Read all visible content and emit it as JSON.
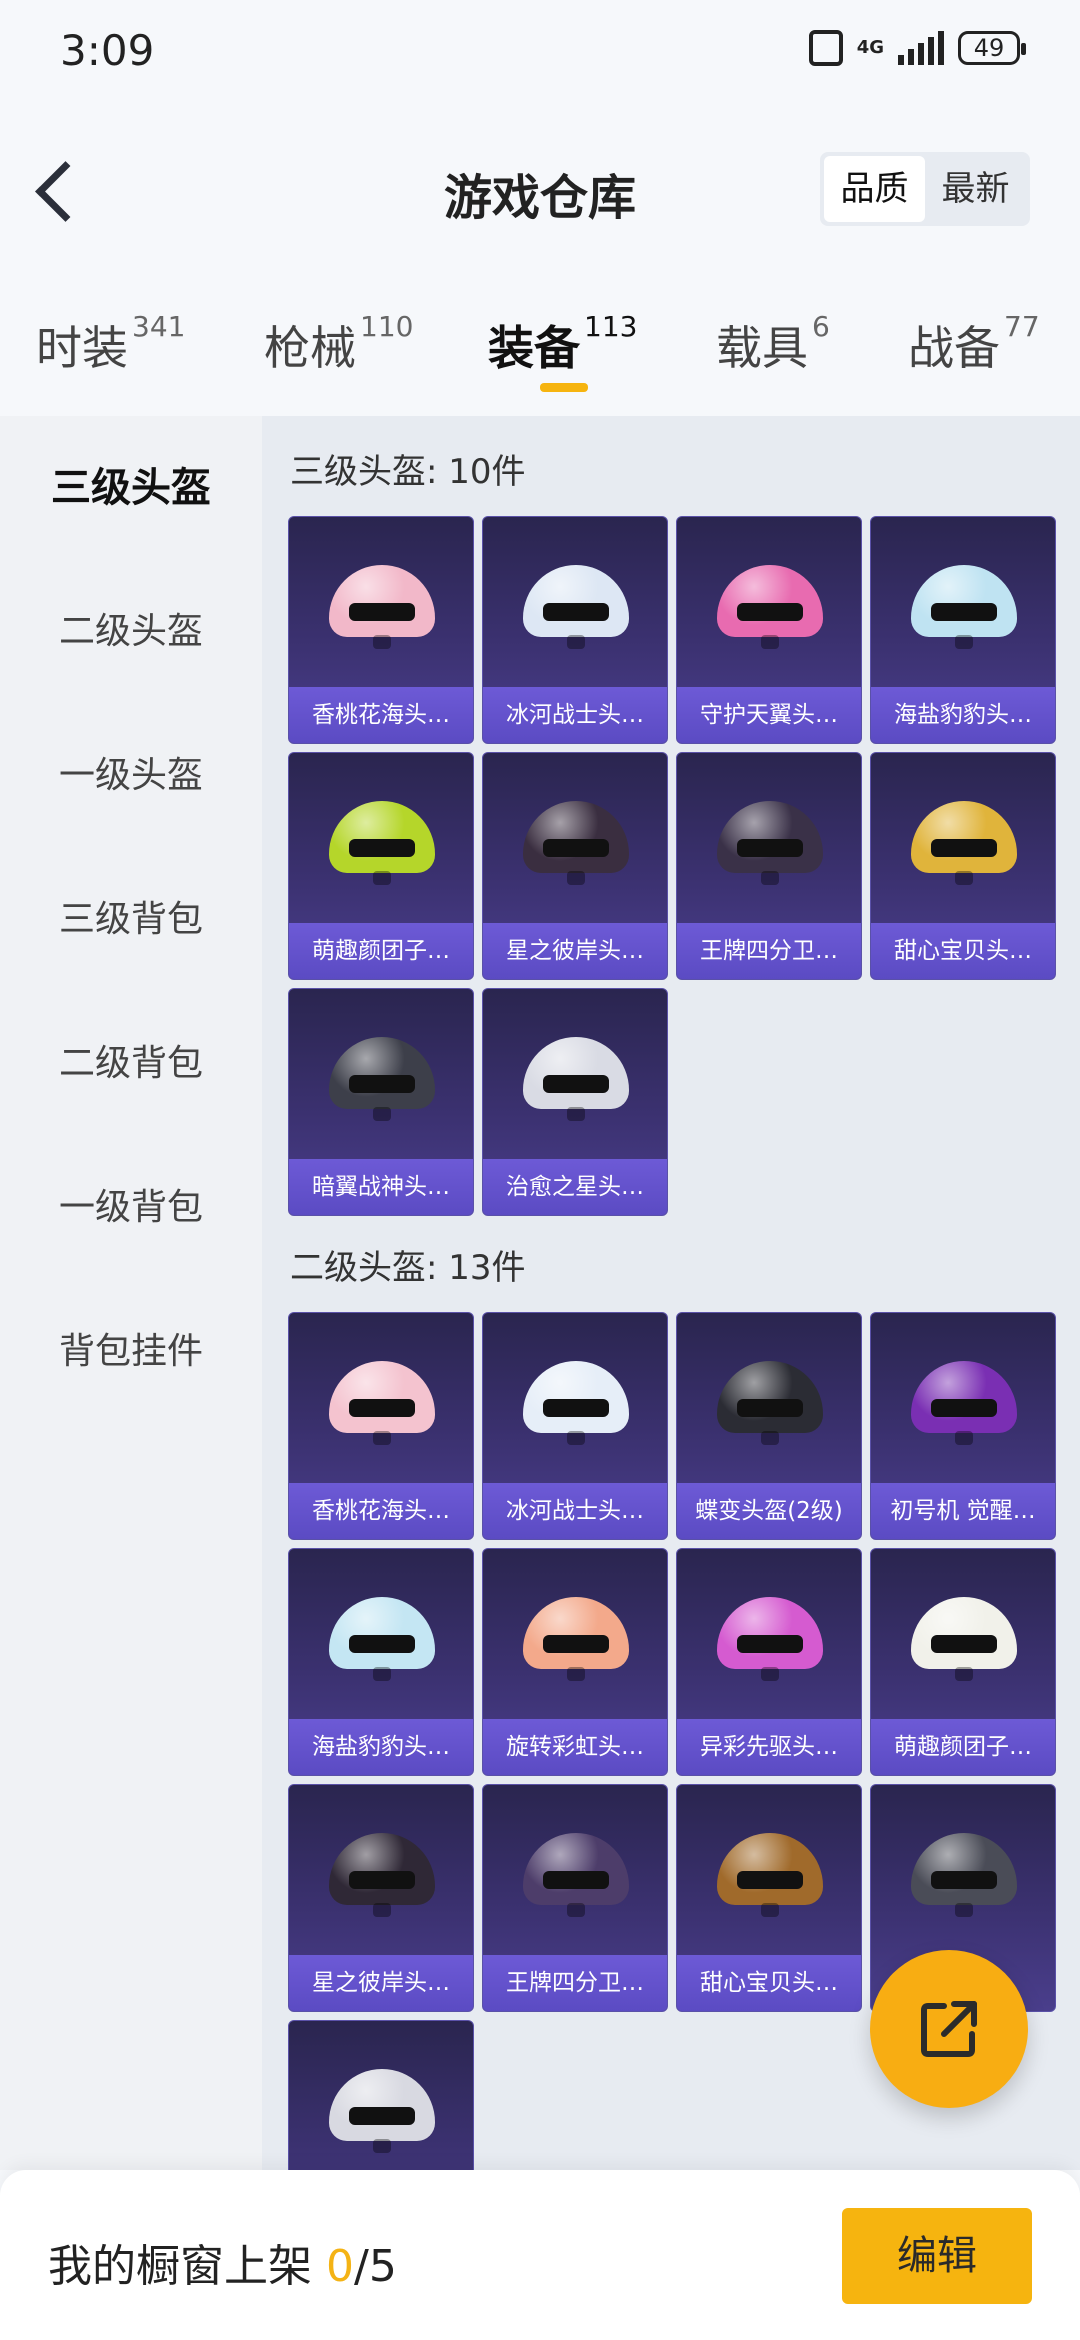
{
  "status_bar": {
    "time": "3:09",
    "network": "4G",
    "battery": "49"
  },
  "header": {
    "title": "游戏仓库",
    "sort_options": [
      "品质",
      "最新"
    ],
    "sort_selected": "品质"
  },
  "tabs": [
    {
      "label": "时装",
      "count": "341"
    },
    {
      "label": "枪械",
      "count": "110"
    },
    {
      "label": "装备",
      "count": "113",
      "active": true
    },
    {
      "label": "载具",
      "count": "6"
    },
    {
      "label": "战备",
      "count": "77"
    }
  ],
  "sidebar": {
    "items": [
      {
        "label": "三级头盔",
        "active": true
      },
      {
        "label": "二级头盔"
      },
      {
        "label": "一级头盔"
      },
      {
        "label": "三级背包"
      },
      {
        "label": "二级背包"
      },
      {
        "label": "一级背包"
      },
      {
        "label": "背包挂件"
      }
    ]
  },
  "sections": [
    {
      "title": "三级头盔: 10件",
      "items": [
        {
          "name": "香桃花海头…",
          "color": "#f2b8c9"
        },
        {
          "name": "冰河战士头…",
          "color": "#dde7f4"
        },
        {
          "name": "守护天翼头…",
          "color": "#e86bb0"
        },
        {
          "name": "海盐豹豹头…",
          "color": "#bfe3f2"
        },
        {
          "name": "萌趣颜团子…",
          "color": "#b5d62a"
        },
        {
          "name": "星之彼岸头…",
          "color": "#3a2e40"
        },
        {
          "name": "王牌四分卫…",
          "color": "#3a3148"
        },
        {
          "name": "甜心宝贝头…",
          "color": "#e0b43b"
        },
        {
          "name": "暗翼战神头…",
          "color": "#3d3f4a"
        },
        {
          "name": "治愈之星头…",
          "color": "#d9dbe4"
        }
      ]
    },
    {
      "title": "二级头盔: 13件",
      "items": [
        {
          "name": "香桃花海头…",
          "color": "#f4c3cf"
        },
        {
          "name": "冰河战士头…",
          "color": "#e6eef8"
        },
        {
          "name": "蝶变头盔(2级)",
          "color": "#2b2c34"
        },
        {
          "name": "初号机 觉醒…",
          "color": "#7a2fb3"
        },
        {
          "name": "海盐豹豹头…",
          "color": "#c4e6f3"
        },
        {
          "name": "旋转彩虹头…",
          "color": "#f3a98b"
        },
        {
          "name": "异彩先驱头…",
          "color": "#d55bd0"
        },
        {
          "name": "萌趣颜团子…",
          "color": "#f1f1ea"
        },
        {
          "name": "星之彼岸头…",
          "color": "#2f2836"
        },
        {
          "name": "王牌四分卫…",
          "color": "#4d3d6a"
        },
        {
          "name": "甜心宝贝头…",
          "color": "#a06a2b"
        },
        {
          "name": "",
          "color": "#4a4c57"
        },
        {
          "name": "",
          "color": "#d8d9e1"
        }
      ]
    }
  ],
  "bottom_bar": {
    "shelf_label": "我的橱窗上架",
    "shelf_current": "0",
    "shelf_total": "/5",
    "edit_label": "编辑"
  }
}
